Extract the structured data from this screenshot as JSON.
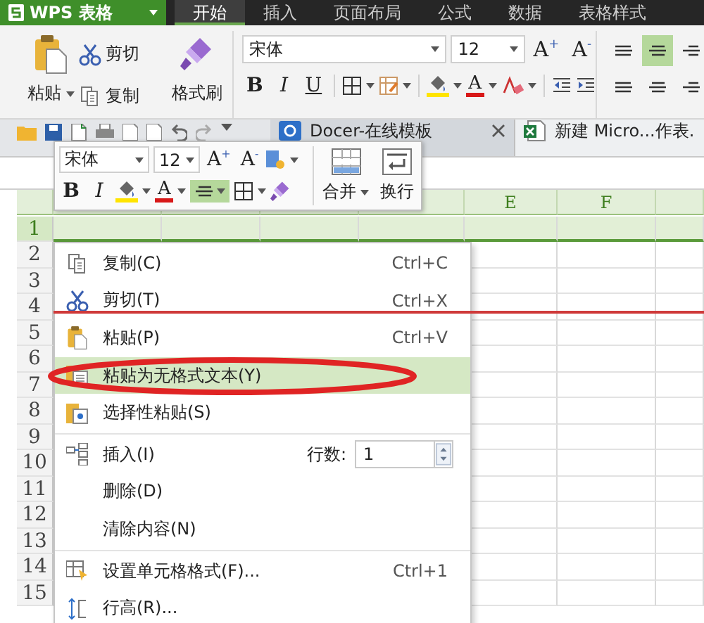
{
  "app_menu": {
    "label": "WPS 表格"
  },
  "tabs": [
    {
      "label": "开始",
      "selected": true
    },
    {
      "label": "插入",
      "selected": false
    },
    {
      "label": "页面布局",
      "selected": false
    },
    {
      "label": "公式",
      "selected": false
    },
    {
      "label": "数据",
      "selected": false
    },
    {
      "label": "表格样式",
      "selected": false
    }
  ],
  "ribbon": {
    "paste": "粘贴",
    "cut": "剪切",
    "copy": "复制",
    "format_painter": "格式刷",
    "font": "宋体",
    "font_size": "12",
    "grow_font": "A$^{+}$",
    "shrink_font": "A$^{-}$",
    "bold": "B",
    "italic": "I",
    "underline": "U",
    "font_color": "A",
    "align_buttons": [
      {
        "selected": false
      },
      {
        "selected": true
      },
      {
        "selected": false
      },
      {
        "selected": false
      },
      {
        "selected": false
      },
      {
        "selected": false
      }
    ]
  },
  "doc_tabs": [
    {
      "label": "Docer-在线模板",
      "closable": true
    },
    {
      "label": "新建 Micro...作表.",
      "closable": false
    }
  ],
  "grid": {
    "columns": [
      {
        "label": "E"
      },
      {
        "label": "F"
      }
    ],
    "rows": [
      {
        "label": "1",
        "selected": true
      },
      {
        "label": "2",
        "selected": false
      },
      {
        "label": "3",
        "selected": false
      },
      {
        "label": "4",
        "selected": false
      },
      {
        "label": "5",
        "selected": false
      },
      {
        "label": "6",
        "selected": false
      },
      {
        "label": "7",
        "selected": false
      },
      {
        "label": "8",
        "selected": false
      },
      {
        "label": "9",
        "selected": false
      },
      {
        "label": "10",
        "selected": false
      },
      {
        "label": "11",
        "selected": false
      },
      {
        "label": "12",
        "selected": false
      },
      {
        "label": "13",
        "selected": false
      },
      {
        "label": "14",
        "selected": false
      },
      {
        "label": "15",
        "selected": false
      }
    ]
  },
  "mini_toolbar": {
    "font": "宋体",
    "font_size": "12",
    "grow_font": "A$^{+}$",
    "shrink_font": "A$^{-}$",
    "bold": "B",
    "italic": "I",
    "font_color": "A",
    "align": {
      "selected": true
    },
    "merge": "合并",
    "wrap": "换行"
  },
  "context_menu": {
    "items": [
      {
        "kind": "command",
        "label": "复制(C)",
        "shortcut": "Ctrl+C",
        "selected": false
      },
      {
        "kind": "command",
        "label": "剪切(T)",
        "shortcut": "Ctrl+X",
        "selected": false
      },
      {
        "kind": "command",
        "label": "粘贴(P)",
        "shortcut": "Ctrl+V",
        "selected": false
      },
      {
        "kind": "command",
        "label": "粘贴为无格式文本(Y)",
        "selected": true
      },
      {
        "kind": "command",
        "label": "选择性粘贴(S)",
        "selected": false
      },
      {
        "kind": "separator"
      },
      {
        "kind": "insert",
        "label": "插入(I)",
        "count_label": "行数:",
        "count": "1",
        "selected": false
      },
      {
        "kind": "command",
        "label": "删除(D)",
        "selected": false
      },
      {
        "kind": "command",
        "label": "清除内容(N)",
        "selected": false
      },
      {
        "kind": "separator"
      },
      {
        "kind": "command",
        "label": "设置单元格格式(F)...",
        "shortcut": "Ctrl+1",
        "selected": false
      },
      {
        "kind": "command",
        "label": "行高(R)...",
        "selected": false
      }
    ]
  },
  "annotations": {
    "line": true,
    "ellipse": true
  }
}
